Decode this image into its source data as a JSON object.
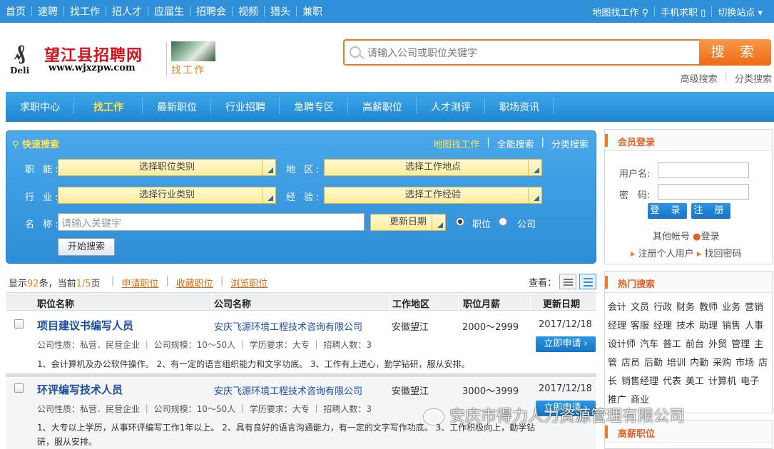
{
  "topbar": {
    "nav": [
      "首页",
      "速聘",
      "找工作",
      "招人才",
      "应届生",
      "招聘会",
      "视频",
      "猎头",
      "兼职"
    ],
    "right": [
      "地图找工作",
      "手机求职",
      "切换站点"
    ]
  },
  "logo": {
    "cn": "望江县招聘网",
    "url": "www.wjxzpw.com",
    "brand": "Deli",
    "sub": "找工作"
  },
  "search": {
    "placeholder": "请输入公司或职位关键字",
    "button": "搜 索",
    "adv": "高级搜索",
    "cat": "分类搜索"
  },
  "mainnav": [
    "求职中心",
    "找工作",
    "最新职位",
    "行业招聘",
    "急聘专区",
    "高薪职位",
    "人才测评",
    "职场资讯"
  ],
  "quick": {
    "title": "快速搜索",
    "links": [
      "地图找工作",
      "全能搜索",
      "分类搜索"
    ],
    "labels": {
      "func": "职 能:",
      "area": "地 区:",
      "industry": "行 业:",
      "exp": "经 验:",
      "name": "名 称:"
    },
    "selects": {
      "func": "选择职位类别",
      "area": "选择工作地点",
      "industry": "选择行业类别",
      "exp": "选择工作经验",
      "date": "更新日期"
    },
    "keyword_placeholder": "请输入关键字",
    "radio": [
      "职位",
      "公司"
    ],
    "go": "开始搜索"
  },
  "listbar": {
    "prefix": "显示",
    "total": "92",
    "mid": "条，当前",
    "page": "1/5",
    "suffix": "页",
    "acts": [
      "申请职位",
      "收藏职位",
      "浏览职位"
    ],
    "view": "查看："
  },
  "table": {
    "headers": [
      "职位名称",
      "公司名称",
      "工作地区",
      "职位月薪",
      "更新日期"
    ]
  },
  "jobs": [
    {
      "title": "项目建议书编写人员",
      "company": "安庆飞源环境工程技术咨询有限公司",
      "location": "安徽望江",
      "salary": "2000～2999",
      "date": "2017/12/18",
      "meta": "公司性质：私营．民营企业 ｜ 公司规模：10～50人 ｜ 学历要求：大专 ｜ 招聘人数：3",
      "desc": "1、会计算机及办公软件操作。 2、有一定的语言组织能力和文字功底。 3、工作有上进心，勤学钻研，服从安排。",
      "apply": "立即申请"
    },
    {
      "title": "环评编写技术人员",
      "company": "安庆飞源环境工程技术咨询有限公司",
      "location": "安徽望江",
      "salary": "3000～3999",
      "date": "2017/12/18",
      "meta": "公司性质：私营．民营企业 ｜ 公司规模：10～50人 ｜ 学历要求：大专 ｜ 招聘人数：3",
      "desc": "1、大专以上学历，从事环评编写工作1年以上。 2、具有良好的语言沟通能力，有一定的文字写作功底。 3、工作积极向上，勤学钻研，服从安排。",
      "apply": "立即申请"
    }
  ],
  "login": {
    "title": "会员登录",
    "user": "用户名:",
    "pwd": "密　码:",
    "login": "登 录",
    "register": "注 册",
    "other": "其他帐号",
    "qq": "登录",
    "reg_personal": "注册个人用户",
    "recover": "找回密码"
  },
  "hot": {
    "title": "热门搜索",
    "words": [
      "会计",
      "文员",
      "行政",
      "财务",
      "教师",
      "业务",
      "营销",
      "经理",
      "客服",
      "经理",
      "技术",
      "助理",
      "销售",
      "人事",
      "设计师",
      "汽车",
      "普工",
      "前台",
      "外贸",
      "管理",
      "主管",
      "店员",
      "后勤",
      "培训",
      "内勤",
      "采购",
      "市场",
      "店长",
      "销售经理",
      "代表",
      "美工",
      "计算机",
      "电子",
      "推广",
      "商业"
    ]
  },
  "high": {
    "title": "高薪职位"
  },
  "watermark": "安庆市得力人力资源管理有限公司",
  "colors": {
    "accent": "#2f8fd8",
    "orange": "#f07a22",
    "link": "#1c4da1"
  }
}
